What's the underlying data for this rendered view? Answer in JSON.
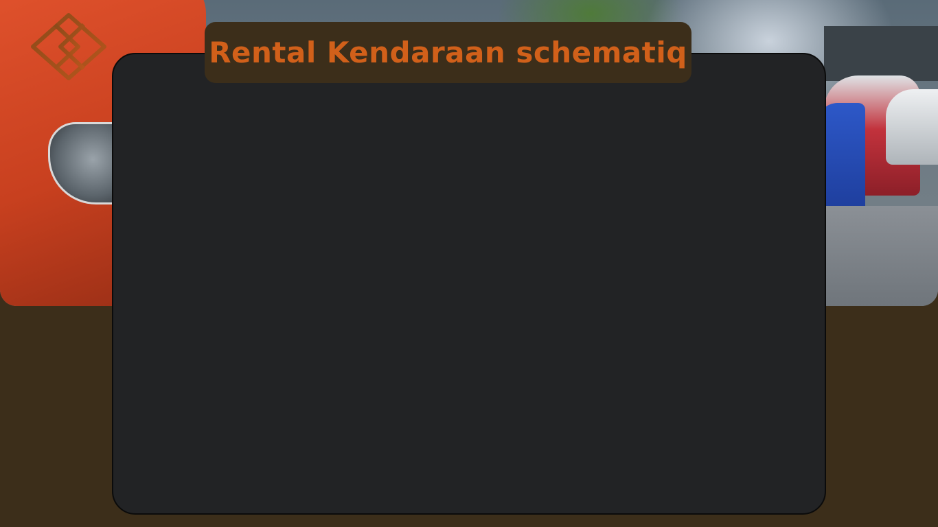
{
  "header": {
    "title": "Rental Kendaraan schematiq"
  },
  "brand": {
    "logo_icon": "interlocking-diamond-logo-icon",
    "accent_color": "#d1601a",
    "background_color": "#3c2e1a",
    "panel_color": "#222325"
  },
  "hero": {
    "image": "parked-cars-photo"
  },
  "main": {
    "panel": "empty-content-panel"
  }
}
